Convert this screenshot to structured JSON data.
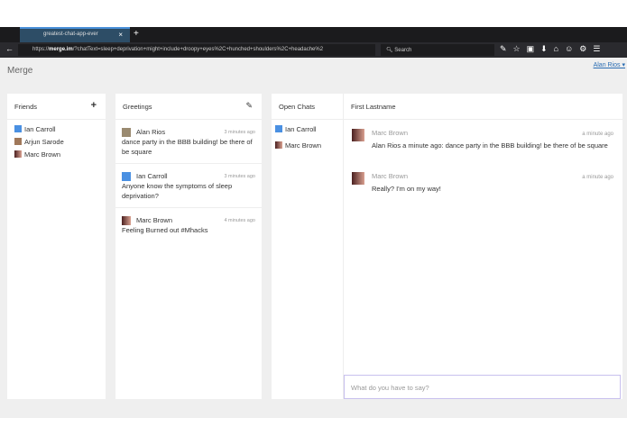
{
  "browser": {
    "tab_title": "greatest-chat-app-ever",
    "tab_close": "×",
    "new_tab": "+",
    "url_prefix": "https://",
    "url_host": "merge.im",
    "url_rest": "/?chatText=sleep+deprivation+might+include+droopy+eyes%2C+hunched+shoulders%2C+headache%2",
    "search_placeholder": "Search",
    "toolbar_icons": "✎☆▣⬇⌂☺⚙☰"
  },
  "header": {
    "brand": "Merge",
    "user": "Alan Rios ▾"
  },
  "friends": {
    "title": "Friends",
    "add": "+",
    "items": [
      {
        "name": "Ian Carroll",
        "avatar": "ic"
      },
      {
        "name": "Arjun Sarode",
        "avatar": "ar"
      },
      {
        "name": "Marc Brown",
        "avatar": "mb"
      }
    ]
  },
  "greetings": {
    "title": "Greetings",
    "compose": "✎",
    "items": [
      {
        "name": "Alan Rios",
        "time": "3 minutes ago",
        "text": "dance party in the BBB building! be there of be square"
      },
      {
        "name": "Ian Carroll",
        "time": "3 minutes ago",
        "text": "Anyone know the symptoms of sleep deprivation?"
      },
      {
        "name": "Marc Brown",
        "time": "4 minutes ago",
        "text": "Feeling Burned out #Mhacks"
      }
    ]
  },
  "open_chats": {
    "title": "Open Chats",
    "items": [
      {
        "name": "Ian Carroll"
      },
      {
        "name": "Marc Brown"
      }
    ]
  },
  "chat": {
    "title": "First Lastname",
    "messages": [
      {
        "name": "Marc Brown",
        "time": "a minute ago",
        "text": "Alan Rios a minute ago: dance party in the BBB building! be there of be square"
      },
      {
        "name": "Marc Brown",
        "time": "a minute ago",
        "text": "Really? I'm on my way!"
      }
    ],
    "input_placeholder": "What do you have to say?"
  }
}
